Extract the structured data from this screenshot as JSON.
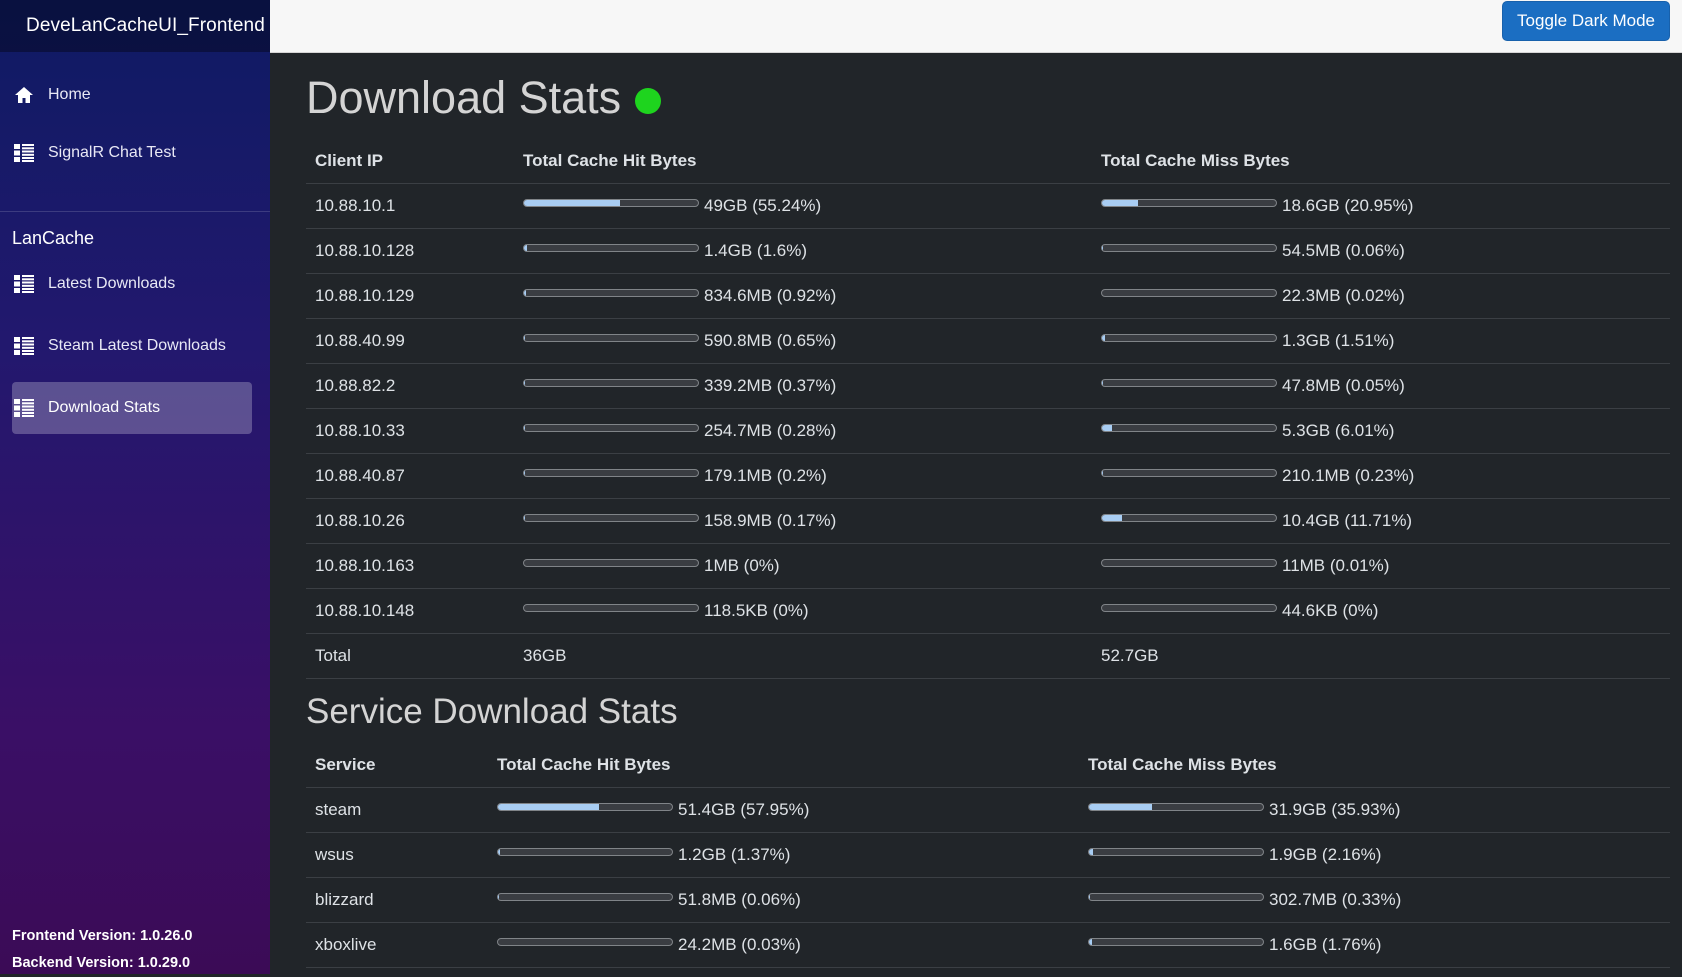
{
  "app": {
    "title": "DeveLanCacheUI_Frontend"
  },
  "sidebar": {
    "items": [
      {
        "label": "Home",
        "icon": "home-icon"
      },
      {
        "label": "SignalR Chat Test",
        "icon": "list-icon"
      }
    ],
    "section_label": "LanCache",
    "section_items": [
      {
        "label": "Latest Downloads",
        "icon": "list-icon"
      },
      {
        "label": "Steam Latest Downloads",
        "icon": "list-icon"
      },
      {
        "label": "Download Stats",
        "icon": "list-icon",
        "active": true
      }
    ],
    "frontend_version": "Frontend Version: 1.0.26.0",
    "backend_version": "Backend Version: 1.0.29.0"
  },
  "topbar": {
    "toggle_label": "Toggle Dark Mode"
  },
  "colors": {
    "accent": "#1b6ec2",
    "status_online": "#1ed41e",
    "bar_fill": "#a8cdf3"
  },
  "download_stats": {
    "title": "Download Stats",
    "headers": [
      "Client IP",
      "Total Cache Hit Bytes",
      "Total Cache Miss Bytes"
    ],
    "rows": [
      {
        "name": "10.88.10.1",
        "hit": "49GB (55.24%)",
        "hit_pct": 55.24,
        "miss": "18.6GB (20.95%)",
        "miss_pct": 20.95
      },
      {
        "name": "10.88.10.128",
        "hit": "1.4GB (1.6%)",
        "hit_pct": 1.6,
        "miss": "54.5MB (0.06%)",
        "miss_pct": 0.06
      },
      {
        "name": "10.88.10.129",
        "hit": "834.6MB (0.92%)",
        "hit_pct": 0.92,
        "miss": "22.3MB (0.02%)",
        "miss_pct": 0.02
      },
      {
        "name": "10.88.40.99",
        "hit": "590.8MB (0.65%)",
        "hit_pct": 0.65,
        "miss": "1.3GB (1.51%)",
        "miss_pct": 1.51
      },
      {
        "name": "10.88.82.2",
        "hit": "339.2MB (0.37%)",
        "hit_pct": 0.37,
        "miss": "47.8MB (0.05%)",
        "miss_pct": 0.05
      },
      {
        "name": "10.88.10.33",
        "hit": "254.7MB (0.28%)",
        "hit_pct": 0.28,
        "miss": "5.3GB (6.01%)",
        "miss_pct": 6.01
      },
      {
        "name": "10.88.40.87",
        "hit": "179.1MB (0.2%)",
        "hit_pct": 0.2,
        "miss": "210.1MB (0.23%)",
        "miss_pct": 0.23
      },
      {
        "name": "10.88.10.26",
        "hit": "158.9MB (0.17%)",
        "hit_pct": 0.17,
        "miss": "10.4GB (11.71%)",
        "miss_pct": 11.71
      },
      {
        "name": "10.88.10.163",
        "hit": "1MB (0%)",
        "hit_pct": 0,
        "miss": "11MB (0.01%)",
        "miss_pct": 0.01
      },
      {
        "name": "10.88.10.148",
        "hit": "118.5KB (0%)",
        "hit_pct": 0,
        "miss": "44.6KB (0%)",
        "miss_pct": 0
      }
    ],
    "total": {
      "label": "Total",
      "hit": "36GB",
      "miss": "52.7GB"
    }
  },
  "service_stats": {
    "title": "Service Download Stats",
    "headers": [
      "Service",
      "Total Cache Hit Bytes",
      "Total Cache Miss Bytes"
    ],
    "rows": [
      {
        "name": "steam",
        "hit": "51.4GB (57.95%)",
        "hit_pct": 57.95,
        "miss": "31.9GB (35.93%)",
        "miss_pct": 35.93
      },
      {
        "name": "wsus",
        "hit": "1.2GB (1.37%)",
        "hit_pct": 1.37,
        "miss": "1.9GB (2.16%)",
        "miss_pct": 2.16
      },
      {
        "name": "blizzard",
        "hit": "51.8MB (0.06%)",
        "hit_pct": 0.06,
        "miss": "302.7MB (0.33%)",
        "miss_pct": 0.33
      },
      {
        "name": "xboxlive",
        "hit": "24.2MB (0.03%)",
        "hit_pct": 0.03,
        "miss": "1.6GB (1.76%)",
        "miss_pct": 1.76
      }
    ]
  }
}
